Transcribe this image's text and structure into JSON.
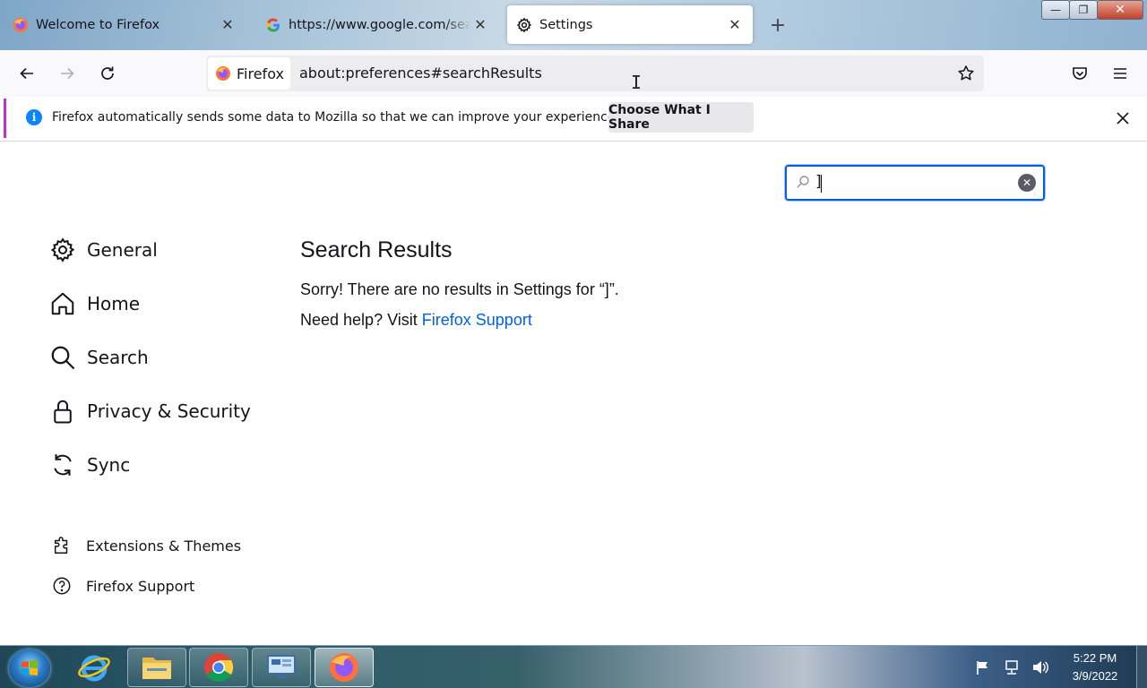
{
  "browser": {
    "tabs": [
      {
        "title": "Welcome to Firefox",
        "icon": "firefox-icon",
        "selected": false
      },
      {
        "title": "https://www.google.com/search",
        "icon": "google-icon",
        "selected": false
      },
      {
        "title": "Settings",
        "icon": "gear-icon",
        "selected": true
      }
    ],
    "new_tab_label": "+",
    "window_controls": {
      "minimize": "—",
      "restore": "❐",
      "close": "✕"
    },
    "identity_label": "Firefox",
    "url": "about:preferences#searchResults"
  },
  "notification": {
    "text": "Firefox automatically sends some data to Mozilla so that we can improve your experience.",
    "button": "Choose What I Share",
    "info_glyph": "i"
  },
  "search": {
    "value": "]"
  },
  "sidebar": {
    "items": [
      {
        "label": "General",
        "icon": "gear-icon"
      },
      {
        "label": "Home",
        "icon": "home-icon"
      },
      {
        "label": "Search",
        "icon": "search-icon"
      },
      {
        "label": "Privacy & Security",
        "icon": "lock-icon"
      },
      {
        "label": "Sync",
        "icon": "sync-icon"
      }
    ],
    "footer": [
      {
        "label": "Extensions & Themes",
        "icon": "puzzle-icon"
      },
      {
        "label": "Firefox Support",
        "icon": "help-icon"
      }
    ]
  },
  "results": {
    "title": "Search Results",
    "message": "Sorry! There are no results in Settings for “]”.",
    "help_prefix": "Need help? Visit ",
    "help_link": "Firefox Support"
  },
  "taskbar": {
    "apps": [
      "internet-explorer-icon",
      "file-explorer-icon",
      "chrome-icon",
      "remote-desktop-icon",
      "firefox-icon"
    ],
    "time": "5:22 PM",
    "date": "3/9/2022"
  },
  "colors": {
    "accent": "#0060df",
    "link": "#0061e0",
    "notification_bar": "#c62bd4"
  }
}
